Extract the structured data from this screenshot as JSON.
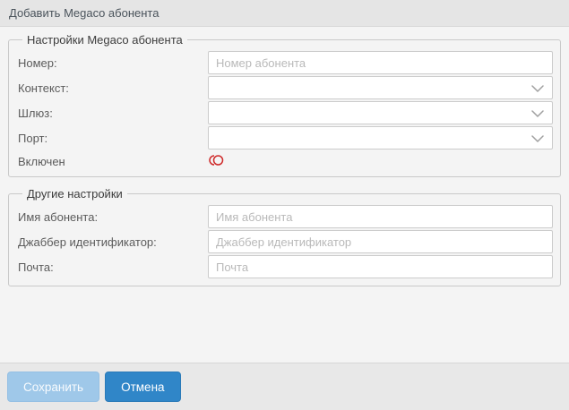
{
  "window": {
    "title": "Добавить Megaco абонента"
  },
  "colors": {
    "titlebar_bg": "#e5e5e5",
    "body_bg": "#f4f4f4",
    "footer_bg": "#e8e8e8",
    "save_button_bg": "#9fc8e9",
    "cancel_button_bg": "#3086c8",
    "toggle_off_red": "#cf2a2a",
    "placeholder_gray": "#b9b9b9"
  },
  "icons": {
    "select_caret": "chevron-down",
    "enabled_state": "toggle-off"
  },
  "sections": [
    {
      "legend": "Настройки Megaco абонента",
      "fields": [
        {
          "label": "Номер:",
          "type": "text",
          "placeholder": "Номер абонента",
          "value": ""
        },
        {
          "label": "Контекст:",
          "type": "select",
          "value": ""
        },
        {
          "label": "Шлюз:",
          "type": "select",
          "value": ""
        },
        {
          "label": "Порт:",
          "type": "select",
          "value": ""
        },
        {
          "label": "Включен",
          "type": "toggle",
          "state": "off"
        }
      ]
    },
    {
      "legend": "Другие настройки",
      "fields": [
        {
          "label": "Имя абонента:",
          "type": "text",
          "placeholder": "Имя абонента",
          "value": ""
        },
        {
          "label": "Джаббер идентификатор:",
          "type": "text",
          "placeholder": "Джаббер идентификатор",
          "value": ""
        },
        {
          "label": "Почта:",
          "type": "text",
          "placeholder": "Почта",
          "value": ""
        }
      ]
    }
  ],
  "footer": {
    "save_label": "Сохранить",
    "cancel_label": "Отмена"
  }
}
